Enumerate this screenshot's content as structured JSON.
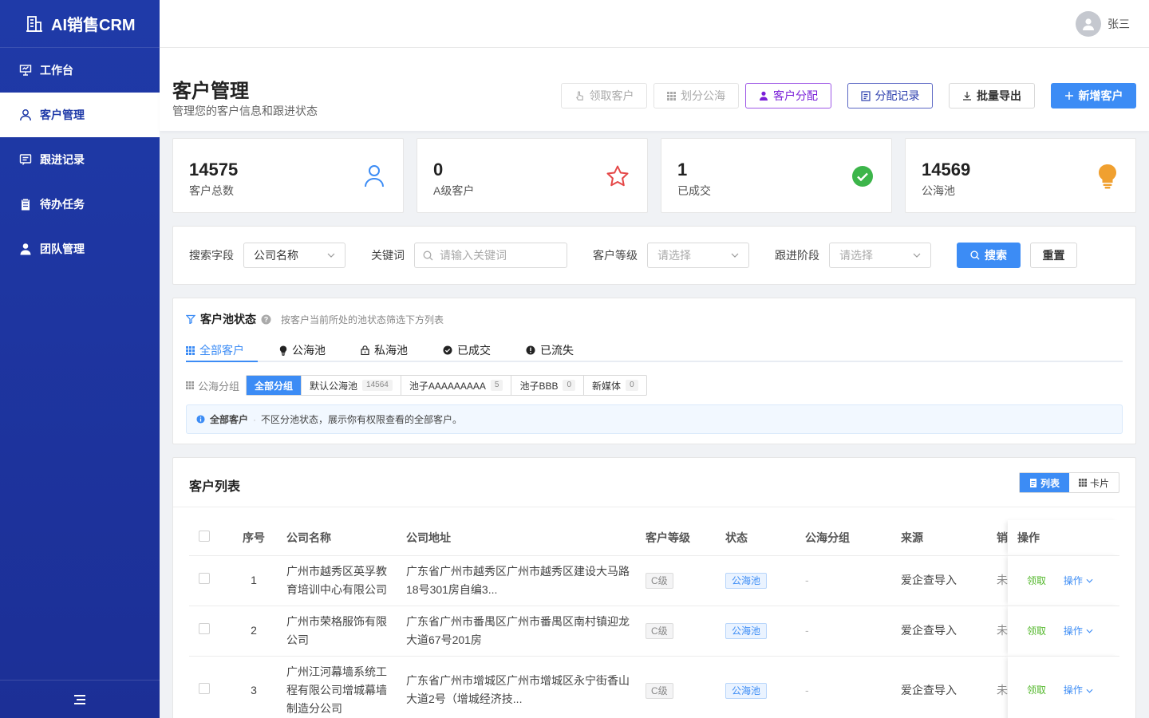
{
  "app": {
    "name": "AI销售CRM"
  },
  "sidebar": {
    "items": [
      {
        "label": "工作台",
        "icon": "presentation-board-icon",
        "active": false
      },
      {
        "label": "客户管理",
        "icon": "user-icon",
        "active": true
      },
      {
        "label": "跟进记录",
        "icon": "message-icon",
        "active": false
      },
      {
        "label": "待办任务",
        "icon": "clipboard-icon",
        "active": false
      },
      {
        "label": "团队管理",
        "icon": "person-icon",
        "active": false
      }
    ],
    "collapse_icon": "menu-icon"
  },
  "topbar": {
    "username": "张三"
  },
  "header": {
    "title": "客户管理",
    "subtitle": "管理您的客户信息和跟进状态",
    "actions": {
      "claim": "领取客户",
      "divide_pool": "划分公海",
      "assign": "客户分配",
      "assign_log": "分配记录",
      "export": "批量导出",
      "add": "新增客户"
    }
  },
  "stats": [
    {
      "value": "14575",
      "label": "客户总数",
      "icon": "user-outline-icon",
      "color": "#3c8cf5"
    },
    {
      "value": "0",
      "label": "A级客户",
      "icon": "star-outline-icon",
      "color": "#e54848"
    },
    {
      "value": "1",
      "label": "已成交",
      "icon": "check-circle-icon",
      "color": "#3cb54a"
    },
    {
      "value": "14569",
      "label": "公海池",
      "icon": "bulb-icon",
      "color": "#f0a030"
    }
  ],
  "search": {
    "field_label": "搜索字段",
    "field_value": "公司名称",
    "keyword_label": "关键词",
    "keyword_placeholder": "请输入关键词",
    "level_label": "客户等级",
    "level_placeholder": "请选择",
    "stage_label": "跟进阶段",
    "stage_placeholder": "请选择",
    "search_btn": "搜索",
    "reset_btn": "重置"
  },
  "pool": {
    "title": "客户池状态",
    "hint": "按客户当前所处的池状态筛选下方列表",
    "tabs": [
      {
        "label": "全部客户",
        "icon": "grid-icon",
        "active": true
      },
      {
        "label": "公海池",
        "icon": "bulb-icon",
        "active": false
      },
      {
        "label": "私海池",
        "icon": "lock-icon",
        "active": false
      },
      {
        "label": "已成交",
        "icon": "check-circle-icon",
        "active": false
      },
      {
        "label": "已流失",
        "icon": "exclamation-circle-icon",
        "active": false
      }
    ],
    "group_label": "公海分组",
    "groups": [
      {
        "label": "全部分组",
        "count": "",
        "active": true
      },
      {
        "label": "默认公海池",
        "count": "14564",
        "active": false
      },
      {
        "label": "池子AAAAAAAAA",
        "count": "5",
        "active": false
      },
      {
        "label": "池子BBB",
        "count": "0",
        "active": false
      },
      {
        "label": "新媒体",
        "count": "0",
        "active": false
      }
    ],
    "info_title": "全部客户",
    "info_text": "不区分池状态，展示你有权限查看的全部客户。"
  },
  "list": {
    "title": "客户列表",
    "view_list": "列表",
    "view_card": "卡片",
    "columns": {
      "index": "序号",
      "company": "公司名称",
      "address": "公司地址",
      "level": "客户等级",
      "status": "状态",
      "group": "公海分组",
      "source": "来源",
      "extra": "销",
      "ops": "操作"
    },
    "rows": [
      {
        "index": "1",
        "company": "广州市越秀区英孚教育培训中心有限公司",
        "address": "广东省广州市越秀区广州市越秀区建设大马路18号301房自编3...",
        "level": "C级",
        "status": "公海池",
        "group": "-",
        "source": "爱企查导入",
        "extra": "未",
        "claim": "领取",
        "op": "操作"
      },
      {
        "index": "2",
        "company": "广州市荣格服饰有限公司",
        "address": "广东省广州市番禺区广州市番禺区南村镇迎龙大道67号201房",
        "level": "C级",
        "status": "公海池",
        "group": "-",
        "source": "爱企查导入",
        "extra": "未",
        "claim": "领取",
        "op": "操作"
      },
      {
        "index": "3",
        "company": "广州江河幕墙系统工程有限公司增城幕墙制造分公司",
        "address": "广东省广州市增城区广州市增城区永宁街香山大道2号（增城经济技...",
        "level": "C级",
        "status": "公海池",
        "group": "-",
        "source": "爱企查导入",
        "extra": "未",
        "claim": "领取",
        "op": "操作"
      }
    ]
  }
}
